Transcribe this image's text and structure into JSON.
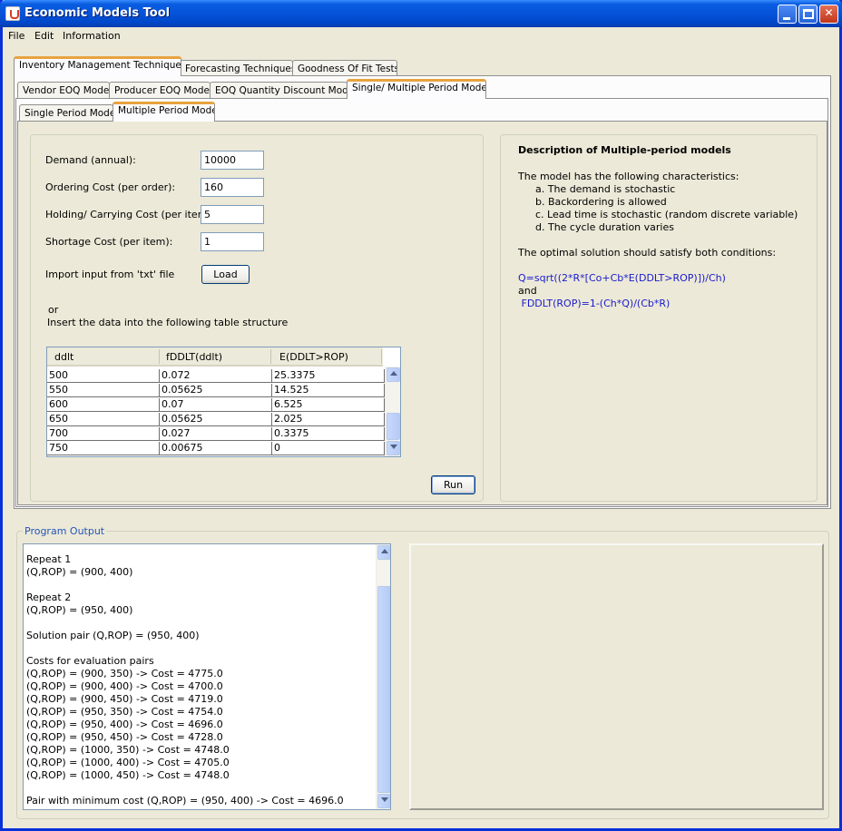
{
  "window": {
    "title": "Economic Models Tool"
  },
  "menu": [
    "File",
    "Edit",
    "Information"
  ],
  "main_tabs": [
    "Inventory Management Techniques",
    "Forecasting Techniques",
    "Goodness Of Fit Tests"
  ],
  "sub_tabs": [
    "Vendor EOQ Model",
    "Producer EOQ Model",
    "EOQ Quantity Discount Model",
    "Single/ Multiple Period Models"
  ],
  "period_tabs": [
    "Single Period Model",
    "Multiple Period Model"
  ],
  "inputs": {
    "demand": {
      "label": "Demand (annual):",
      "value": "10000"
    },
    "ordering": {
      "label": "Ordering Cost  (per order):",
      "value": "160"
    },
    "holding": {
      "label": "Holding/ Carrying Cost (per item):",
      "value": "5"
    },
    "shortage": {
      "label": "Shortage Cost (per item):",
      "value": "1"
    },
    "import_label": "Import input from 'txt' file",
    "load_button": "Load",
    "or_text": "or",
    "insert_text": "Insert the data into the following table structure",
    "run_button": "Run"
  },
  "table": {
    "columns": [
      "ddlt",
      "fDDLT(ddlt)",
      "E(DDLT>ROP)"
    ],
    "rows": [
      [
        "500",
        "0.072",
        "25.3375"
      ],
      [
        "550",
        "0.05625",
        "14.525"
      ],
      [
        "600",
        "0.07",
        "6.525"
      ],
      [
        "650",
        "0.05625",
        "2.025"
      ],
      [
        "700",
        "0.027",
        "0.3375"
      ],
      [
        "750",
        "0.00675",
        "0"
      ]
    ]
  },
  "description": {
    "title": "Description of Multiple-period models",
    "intro": "The model has the following characteristics:",
    "items": [
      "a. The demand is stochastic",
      "b. Backordering is allowed",
      "c. Lead time is stochastic (random discrete variable)",
      "d. The cycle duration varies"
    ],
    "conditions": "The optimal solution should satisfy both conditions:",
    "formula1": "Q=sqrt((2*R*[Co+Cb*E(DDLT>ROP)])/Ch)",
    "and": "and",
    "formula2": " FDDLT(ROP)=1-(Ch*Q)/(Cb*R)"
  },
  "output": {
    "title": "Program Output",
    "lines": [
      "Repeat 1",
      "(Q,ROP) = (900, 400)",
      "",
      "Repeat 2",
      "(Q,ROP) = (950, 400)",
      "",
      "Solution pair (Q,ROP) = (950, 400)",
      "",
      "Costs for evaluation pairs",
      "(Q,ROP) = (900, 350) -> Cost = 4775.0",
      "(Q,ROP) = (900, 400) -> Cost = 4700.0",
      "(Q,ROP) = (900, 450) -> Cost = 4719.0",
      "(Q,ROP) = (950, 350) -> Cost = 4754.0",
      "(Q,ROP) = (950, 400) -> Cost = 4696.0",
      "(Q,ROP) = (950, 450) -> Cost = 4728.0",
      "(Q,ROP) = (1000, 350) -> Cost = 4748.0",
      "(Q,ROP) = (1000, 400) -> Cost = 4705.0",
      "(Q,ROP) = (1000, 450) -> Cost = 4748.0",
      "",
      "Pair with minimum cost (Q,ROP) = (950, 400) -> Cost = 4696.0"
    ]
  }
}
